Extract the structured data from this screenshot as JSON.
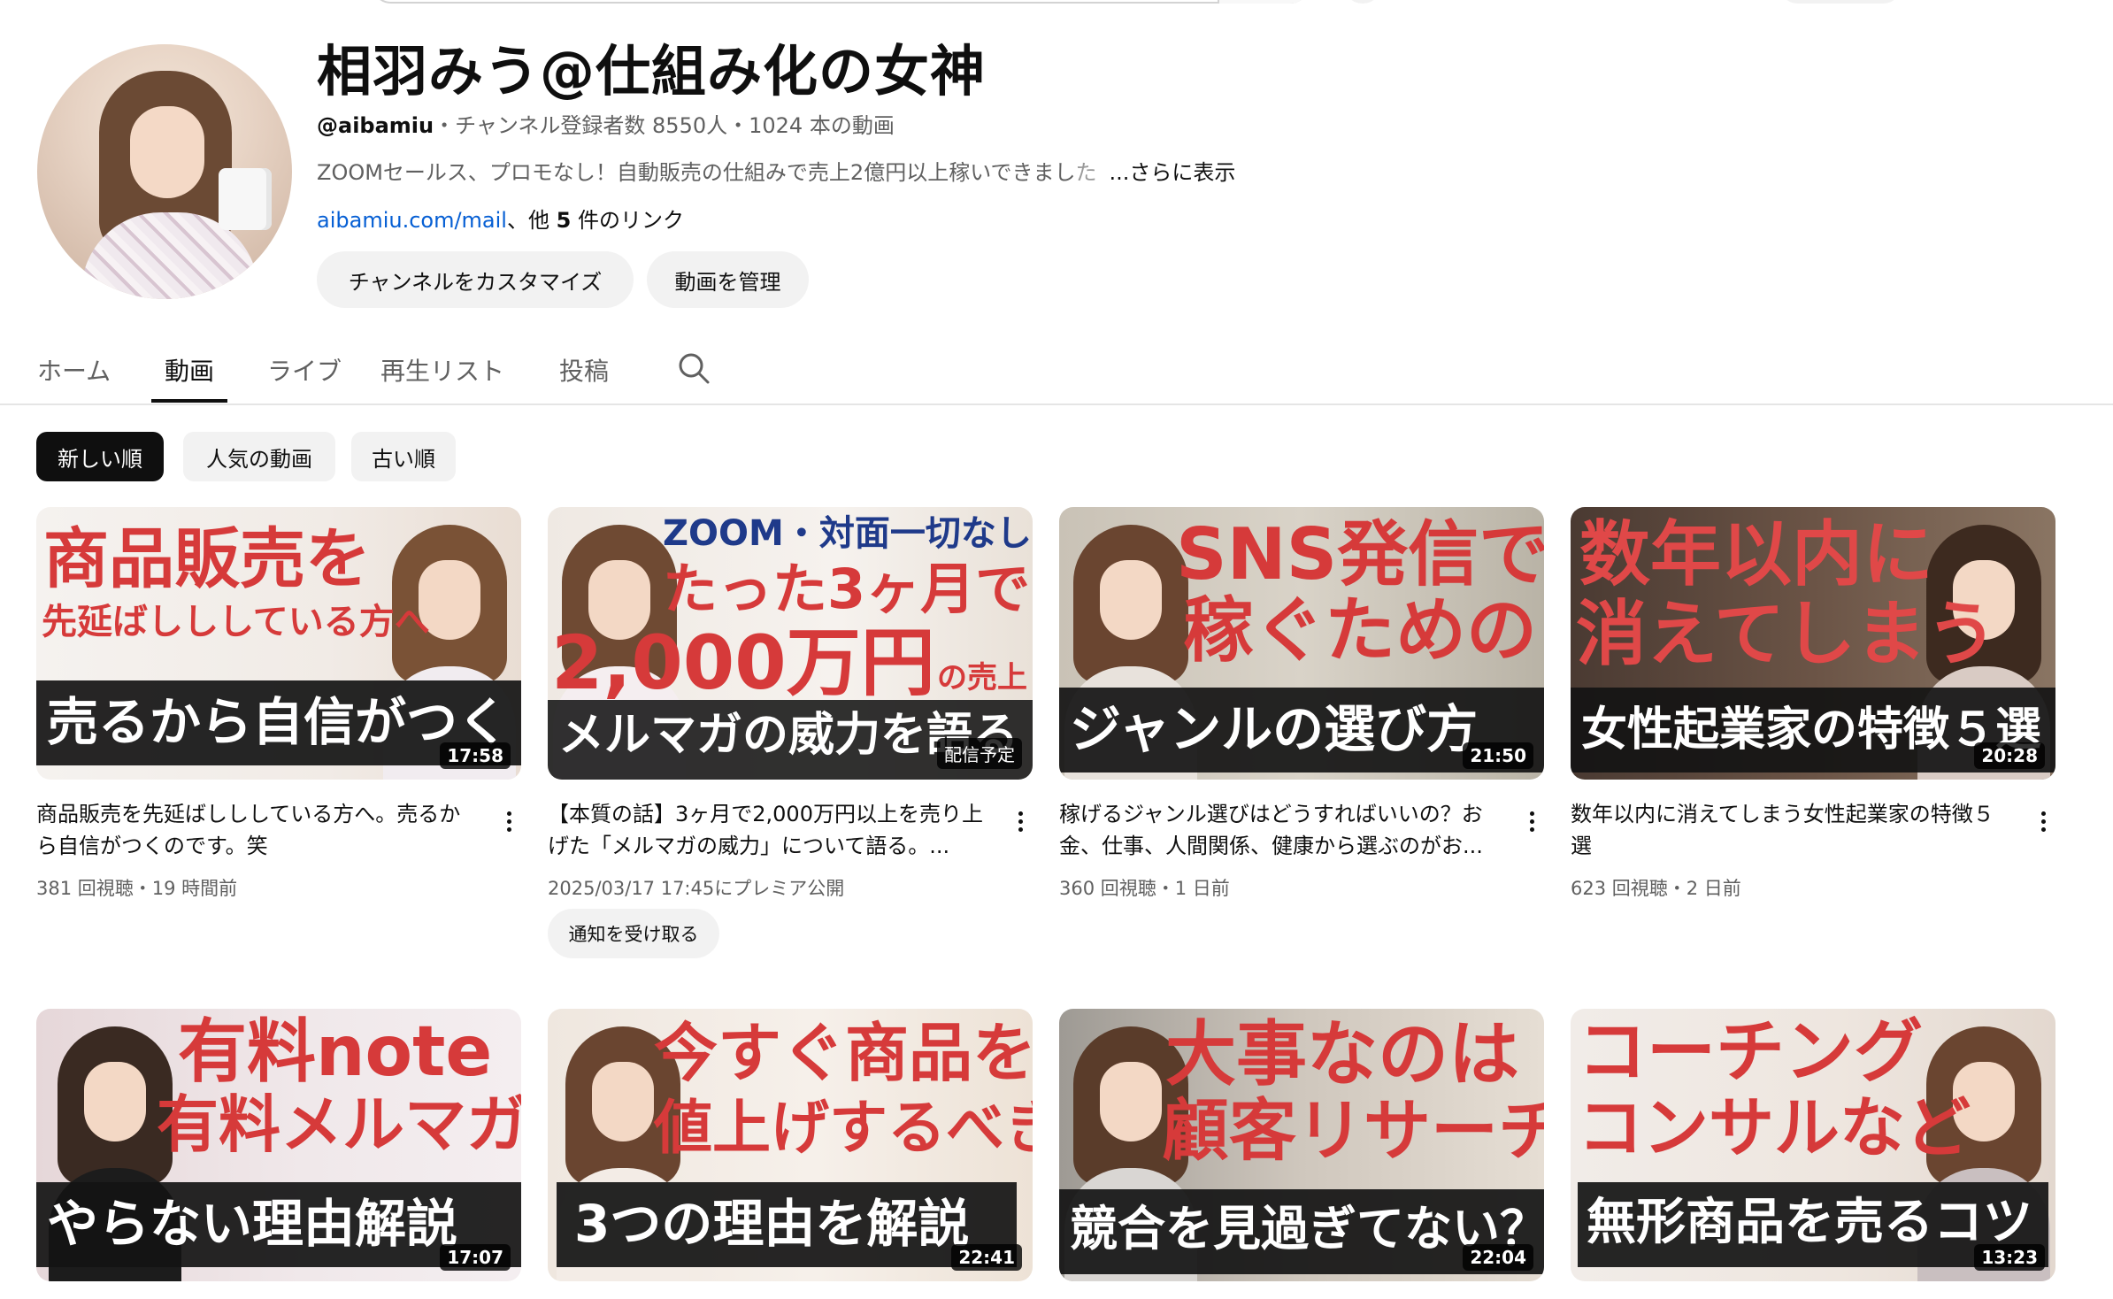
{
  "channel": {
    "name": "相羽みう@仕組み化の女神",
    "handle": "@aibamiu",
    "stats": "・チャンネル登録者数 8550人・1024 本の動画",
    "description": "ZOOMセールス、プロモなし！自動販売の仕組みで売上2億円以上稼いできまし",
    "description_fade": "た",
    "more_label": "...さらに表示",
    "link_text": "aibamiu.com/mail",
    "link_suffix_pre": "、他 ",
    "link_count": "5",
    "link_suffix_post": " 件のリンク",
    "customize_label": "チャンネルをカスタマイズ",
    "manage_label": "動画を管理"
  },
  "tabs": [
    "ホーム",
    "動画",
    "ライブ",
    "再生リスト",
    "投稿"
  ],
  "active_tab": "動画",
  "chips": [
    "新しい順",
    "人気の動画",
    "古い順"
  ],
  "active_chip": "新しい順",
  "videos": [
    {
      "thumb_lines": [
        "商品販売を",
        "先延ばしししている方へ"
      ],
      "band": "売るから自信がつく",
      "duration": "17:58",
      "title": "商品販売を先延ばしししている方へ。売るから自信がつくのです。笑",
      "meta": "381 回視聴・19 時間前"
    },
    {
      "thumb_lines": [
        "ZOOM・対面一切なし！",
        "たった3ヶ月で",
        "2,000万円",
        "の売上"
      ],
      "band": "メルマガの威力を語る",
      "duration": "配信予定",
      "title": "【本質の話】3ヶ月で2,000万円以上を売り上げた「メルマガの威力」について語る。...",
      "meta": "2025/03/17 17:45にプレミア公開",
      "notify_label": "通知を受け取る"
    },
    {
      "thumb_lines": [
        "SNS発信で",
        "稼ぐための"
      ],
      "band": "ジャンルの選び方",
      "duration": "21:50",
      "title": "稼げるジャンル選びはどうすればいいの？お金、仕事、人間関係、健康から選ぶのがお...",
      "meta": "360 回視聴・1 日前"
    },
    {
      "thumb_lines": [
        "数年以内に",
        "消えてしまう"
      ],
      "band": "女性起業家の特徴５選",
      "duration": "20:28",
      "title": "数年以内に消えてしまう女性起業家の特徴５選",
      "meta": "623 回視聴・2 日前"
    },
    {
      "thumb_lines": [
        "有料note",
        "有料メルマガ"
      ],
      "band": "やらない理由解説",
      "duration": "17:07"
    },
    {
      "thumb_lines": [
        "今すぐ商品を",
        "値上げするべき"
      ],
      "band": "3つの理由を解説",
      "duration": "22:41"
    },
    {
      "thumb_lines": [
        "大事なのは",
        "顧客リサーチ"
      ],
      "band": "競合を見過ぎてない？",
      "duration": "22:04"
    },
    {
      "thumb_lines": [
        "コーチング",
        "コンサルなど"
      ],
      "band": "無形商品を売るコツ",
      "duration": "13:23"
    }
  ],
  "colors": {
    "thumb_red": "#d63a3a",
    "thumb_navy": "#1f3a8a",
    "link_blue": "#065fd4"
  }
}
